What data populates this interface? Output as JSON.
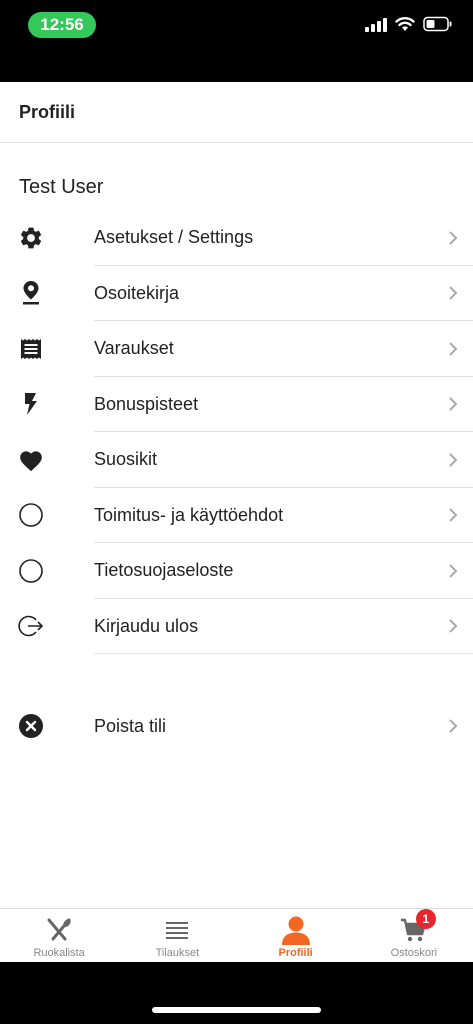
{
  "status_bar": {
    "time": "12:56"
  },
  "header": {
    "title": "Profiili"
  },
  "user": {
    "name": "Test User"
  },
  "menu": {
    "items": [
      {
        "label": "Asetukset / Settings",
        "icon": "gear-icon"
      },
      {
        "label": "Osoitekirja",
        "icon": "location-pin-icon"
      },
      {
        "label": "Varaukset",
        "icon": "receipt-icon"
      },
      {
        "label": "Bonuspisteet",
        "icon": "lightning-icon"
      },
      {
        "label": "Suosikit",
        "icon": "heart-icon"
      },
      {
        "label": "Toimitus- ja käyttöehdot",
        "icon": "circle-outline-icon"
      },
      {
        "label": "Tietosuojaseloste",
        "icon": "circle-outline-icon"
      },
      {
        "label": "Kirjaudu ulos",
        "icon": "logout-icon"
      }
    ],
    "delete": {
      "label": "Poista tili",
      "icon": "close-circle-icon"
    }
  },
  "tabs": [
    {
      "label": "Ruokalista",
      "icon": "fork-knife-icon"
    },
    {
      "label": "Tilaukset",
      "icon": "list-icon"
    },
    {
      "label": "Profiili",
      "icon": "person-icon",
      "active": true
    },
    {
      "label": "Ostoskori",
      "icon": "cart-icon",
      "badge": "1"
    }
  ],
  "colors": {
    "accent": "#f26722",
    "badge": "#e8262c",
    "status_pill": "#34c759"
  }
}
